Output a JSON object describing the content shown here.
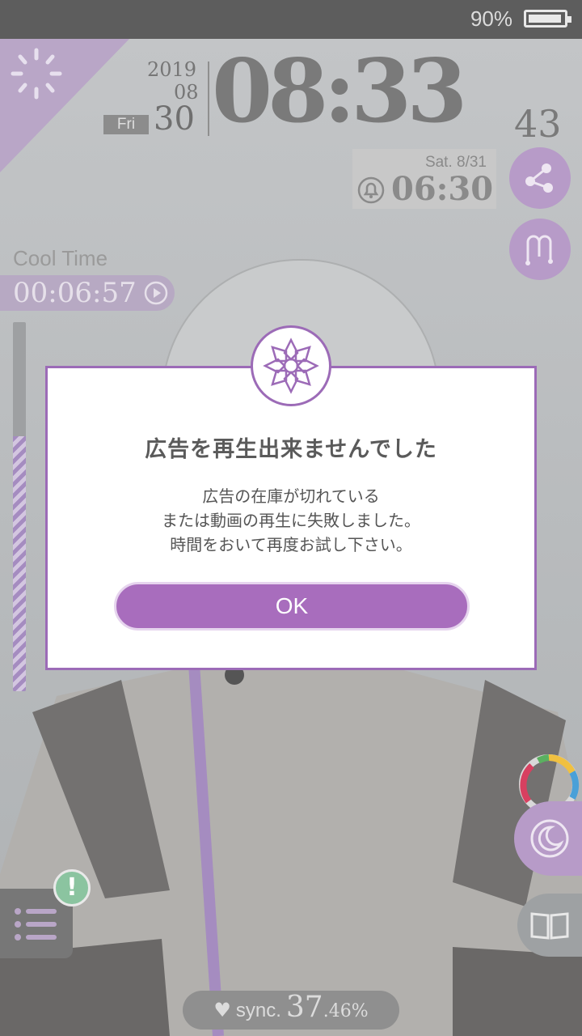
{
  "status_bar": {
    "battery_percent": "90%",
    "battery_level": 0.9
  },
  "clock": {
    "year": "2019",
    "month": "08",
    "weekday": "Fri",
    "day": "30",
    "time": "08:33",
    "seconds": "43"
  },
  "alarm": {
    "date": "Sat.  8/31",
    "time": "06:30"
  },
  "cool_time": {
    "label": "Cool Time",
    "value": "00:06:57"
  },
  "gauge": {
    "fill_fraction": 0.69,
    "fill_color": "#a58cc0"
  },
  "dialog": {
    "title": "広告を再生出来ませんでした",
    "message_lines": [
      "広告の在庫が切れている",
      "または動画の再生に失敗しました。",
      "時間をおいて再度お試し下さい。"
    ],
    "ok_label": "OK"
  },
  "alert_badge": "!",
  "sync": {
    "label": "sync.",
    "integer": "37",
    "decimal": ".46%"
  },
  "colors": {
    "accent": "#a86dbd",
    "dialog_border": "#9c6bb7"
  },
  "icons": [
    "loading-spinner-icon",
    "bell-icon",
    "share-icon",
    "map-mode-icon",
    "play-icon",
    "lotus-emblem-icon",
    "color-ring-icon",
    "moon-icon",
    "book-icon",
    "menu-list-icon",
    "heart-icon",
    "battery-icon"
  ]
}
